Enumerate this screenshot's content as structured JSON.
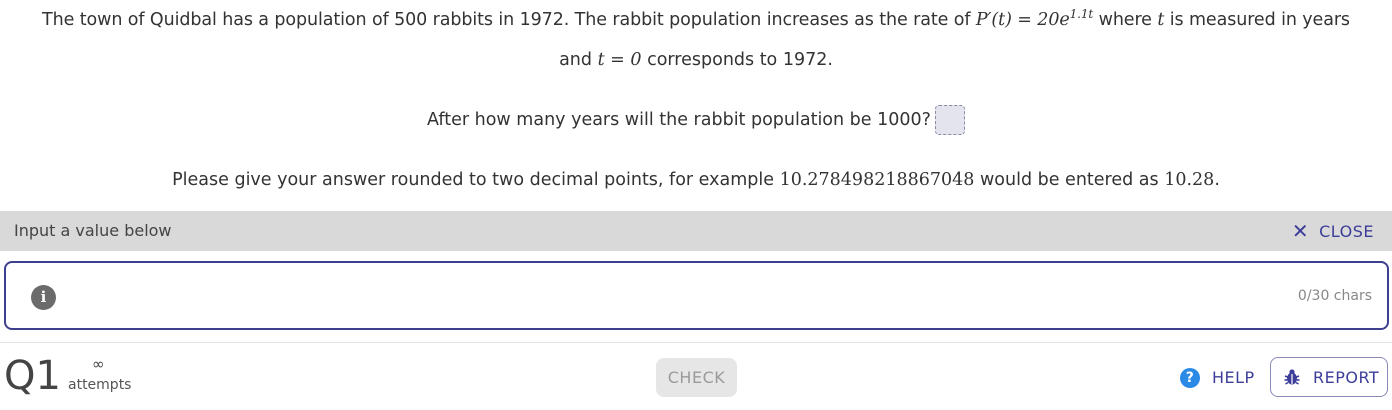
{
  "question": {
    "text_part1": "The town of Quidbal has a population of 500 rabbits in 1972. The rabbit population increases as the rate of ",
    "formula_lhs": "P′(t) = 20e",
    "formula_exponent": "1.1t",
    "text_part2": " where ",
    "var_t": "t",
    "text_part3": " is measured in years",
    "line2_pre": "and ",
    "line2_math": "t = 0",
    "line2_post": " corresponds to 1972.",
    "ask": "After how many years will the rabbit population be 1000?",
    "note_pre": "Please give your answer rounded to two decimal points, for example ",
    "note_example_in": "10.278498218867048",
    "note_mid": " would be entered as ",
    "note_example_out": "10.28",
    "note_post": "."
  },
  "input_panel": {
    "label": "Input a value below",
    "close_label": "CLOSE",
    "char_count": "0/30 chars",
    "value": ""
  },
  "footer": {
    "question_number": "Q1",
    "attempts_symbol": "∞",
    "attempts_label": "attempts",
    "check_label": "CHECK",
    "help_label": "HELP",
    "report_label": "REPORT"
  },
  "colors": {
    "accent": "#3d3d9a",
    "help_icon": "#2a8ae6",
    "input_bar": "#d9d9d9"
  }
}
